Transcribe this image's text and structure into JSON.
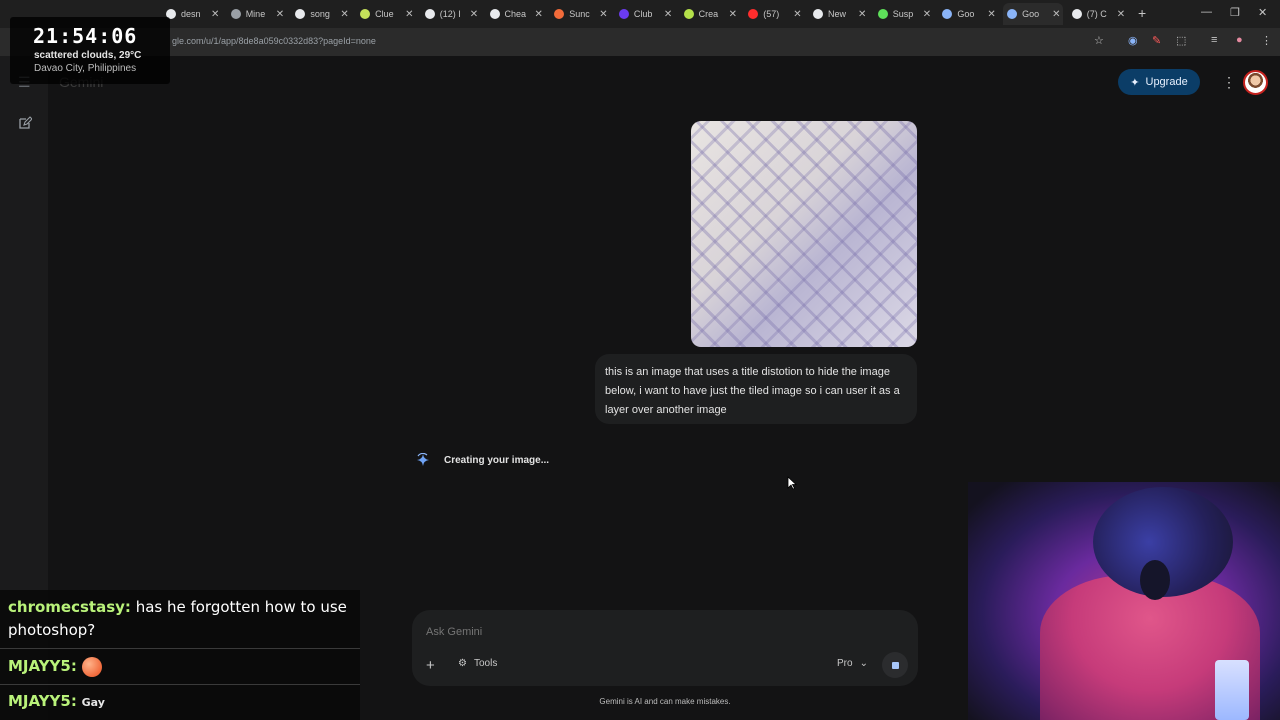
{
  "browser": {
    "tabs": [
      {
        "title": "desn",
        "color": "#e8eaed"
      },
      {
        "title": "Mine",
        "color": "#9aa0a6"
      },
      {
        "title": "song",
        "color": "#e8eaed"
      },
      {
        "title": "Clue",
        "color": "#c5e05a"
      },
      {
        "title": "(12) I",
        "color": "#e8eaed"
      },
      {
        "title": "Chea",
        "color": "#e8eaed"
      },
      {
        "title": "Sunc",
        "color": "#f26b3a"
      },
      {
        "title": "Club",
        "color": "#6b3bf0"
      },
      {
        "title": "Crea",
        "color": "#b4e04a"
      },
      {
        "title": "(57)",
        "color": "#ff2d2d"
      },
      {
        "title": "New",
        "color": "#e8eaed"
      },
      {
        "title": "Susp",
        "color": "#5ee05a"
      },
      {
        "title": "Goo",
        "color": "#8ab4f8"
      },
      {
        "title": "Goo",
        "color": "#8ab4f8"
      },
      {
        "title": "(7) C",
        "color": "#e8eaed"
      }
    ],
    "active_tab_index": 13,
    "new_tab_label": "+",
    "url": "gle.com/u/1/app/8de8a059c0332d83?pageId=none"
  },
  "gemini": {
    "app_title": "Gemini",
    "upgrade_label": "Upgrade",
    "user_prompt": "this is an image that uses a title distotion to hide the image below, i want to have just the tiled image so i can user it as a layer over another image",
    "status_text": "Creating your image...",
    "input_placeholder": "Ask Gemini",
    "tools_label": "Tools",
    "model_label": "Pro",
    "disclaimer": "Gemini is AI and can make mistakes."
  },
  "overlay": {
    "clock_time": "21:54:06",
    "weather": "scattered clouds, 29°C",
    "location": "Davao City, Philippines",
    "chat": [
      {
        "user": "chromecstasy",
        "text": "has he forgotten how to use photoshop?"
      },
      {
        "user": "MJAYY5",
        "text": ""
      },
      {
        "user": "MJAYY5",
        "text": "Gay"
      }
    ]
  },
  "icons": {
    "menu": "menu-icon",
    "new_chat": "new-chat-icon",
    "sparkle": "sparkle-icon",
    "kebab": "more-vert-icon",
    "plus": "plus-icon",
    "tools": "tune-icon",
    "chevron": "chevron-down-icon",
    "stop": "stop-icon"
  }
}
